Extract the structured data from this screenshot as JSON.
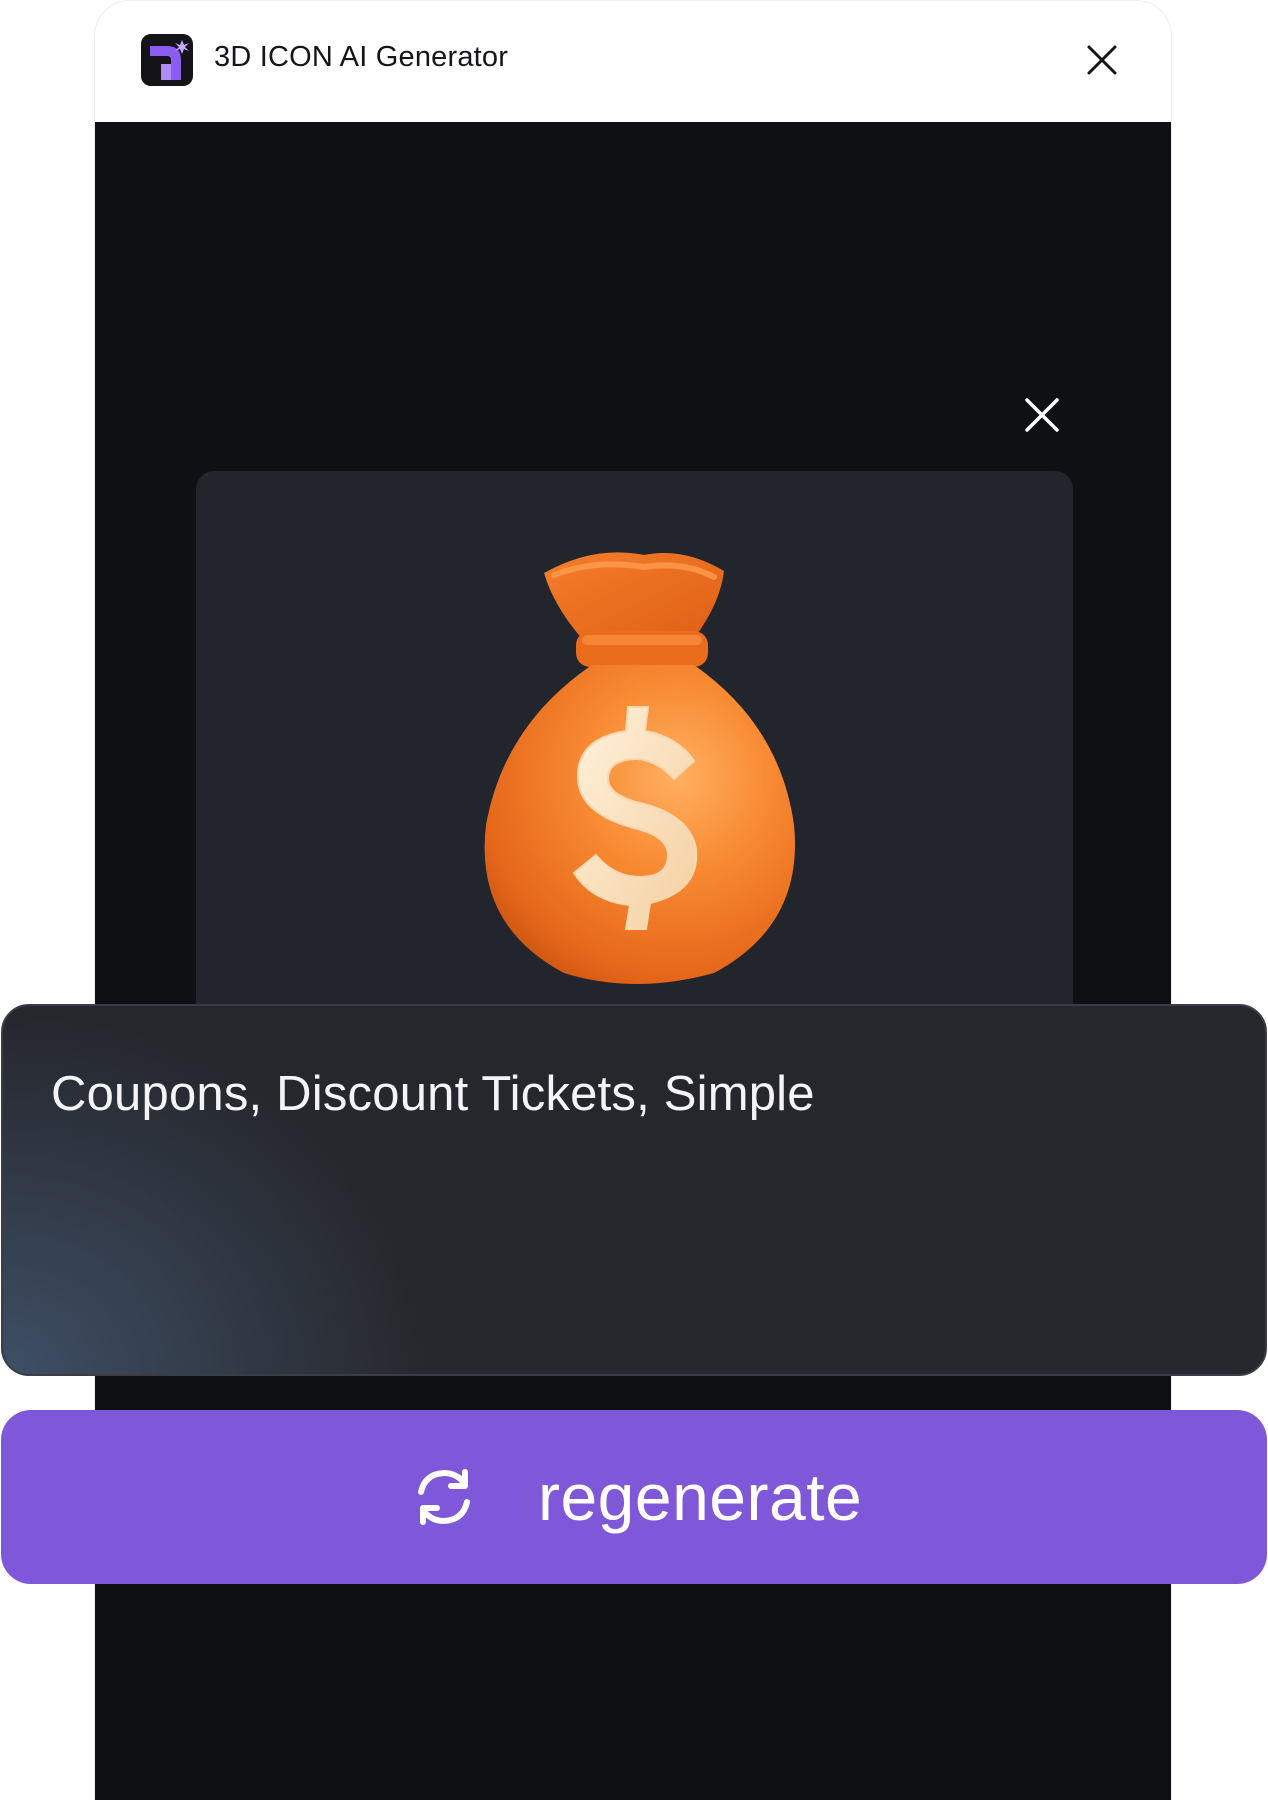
{
  "app": {
    "title": "3D ICON AI Generator",
    "logo_icon": "app-logo-icon",
    "close_icon": "close-icon"
  },
  "preview": {
    "close_icon": "close-icon",
    "image_icon": "money-bag-dollar-icon"
  },
  "prompt": {
    "value": "Coupons, Discount Tickets, Simple"
  },
  "actions": {
    "regenerate_label": "regenerate",
    "regenerate_icon": "refresh-icon"
  },
  "colors": {
    "accent": "#7f57d9",
    "canvas_bg": "#0f1014",
    "card_bg": "#23252d",
    "bag_orange": "#f57a23",
    "dollar_cream": "#fde6c7"
  }
}
